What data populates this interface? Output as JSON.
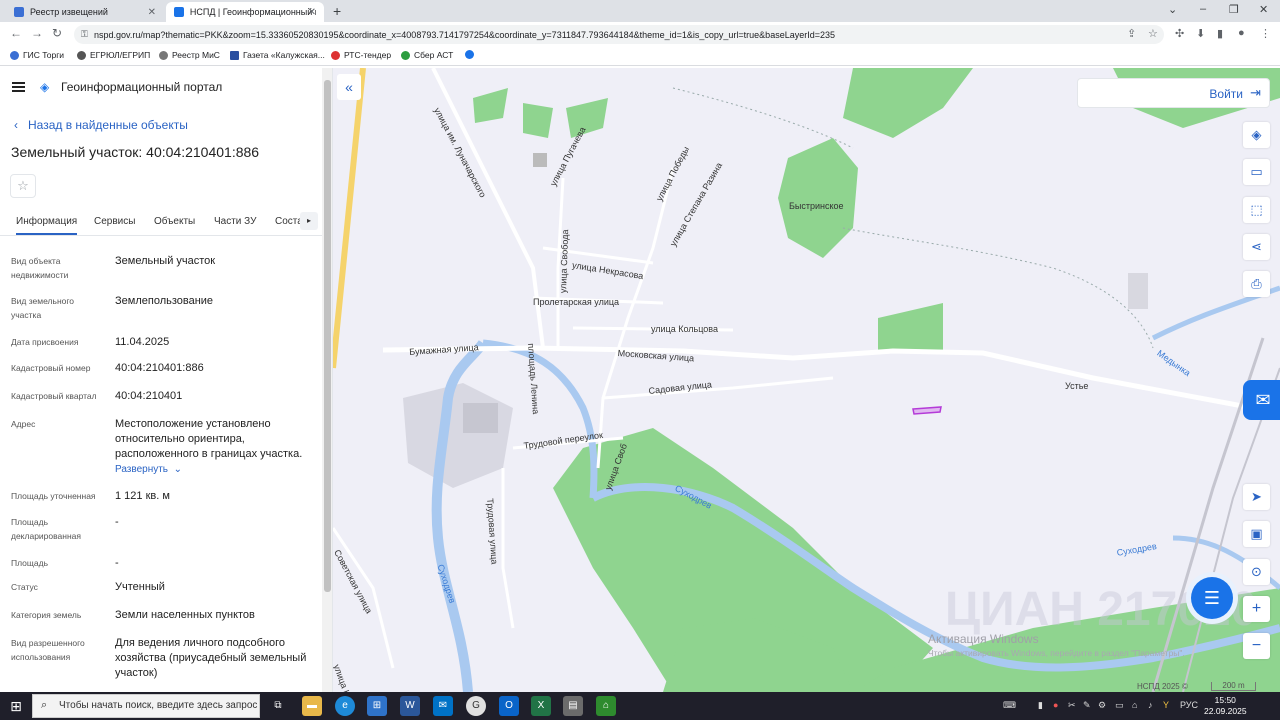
{
  "browser": {
    "tabs": [
      {
        "label": "Реестр извещений",
        "active": false
      },
      {
        "label": "НСПД | Геоинформационный п",
        "active": true
      }
    ],
    "url": "nspd.gov.ru/map?thematic=PKK&zoom=15.33360520830195&coordinate_x=4008793.7141797254&coordinate_y=7311847.793644184&theme_id=1&is_copy_url=true&baseLayerId=235",
    "bookmarks": [
      "ГИС Торги",
      "ЕГРЮЛ/ЕГРИП",
      "Реестр МиС",
      "Газета «Калужская...",
      "РТС-тендер",
      "Сбер АСТ"
    ]
  },
  "panel": {
    "portal_title": "Геоинформационный портал",
    "back_label": "Назад в найденные объекты",
    "object_title": "Земельный участок: 40:04:210401:886",
    "tabs": [
      "Информация",
      "Сервисы",
      "Объекты",
      "Части ЗУ",
      "Соста"
    ],
    "fields": [
      {
        "key": "Вид объекта недвижимости",
        "value": "Земельный участок"
      },
      {
        "key": "Вид земельного участка",
        "value": "Землепользование"
      },
      {
        "key": "Дата присвоения",
        "value": "11.04.2025"
      },
      {
        "key": "Кадастровый номер",
        "value": "40:04:210401:886"
      },
      {
        "key": "Кадастровый квартал",
        "value": "40:04:210401"
      },
      {
        "key": "Адрес",
        "value": "Местоположение установлено относительно ориентира, расположенного в границах участка.",
        "link": "Развернуть"
      },
      {
        "key": "Площадь уточненная",
        "value": "1 121 кв. м"
      },
      {
        "key": "Площадь декларированная",
        "value": "-"
      },
      {
        "key": "Площадь",
        "value": "-"
      },
      {
        "key": "Статус",
        "value": "Учтенный"
      },
      {
        "key": "Категория земель",
        "value": "Земли населенных пунктов"
      },
      {
        "key": "Вид разрешенного использования",
        "value": "Для ведения личного подсобного хозяйства (приусадебный земельный участок)"
      }
    ]
  },
  "map": {
    "login_label": "Войти",
    "labels": {
      "lunacharskogo": "улица им. Луначарского",
      "pugacheva": "улица Пугачева",
      "pobedy": "улица Победы",
      "razina": "улица Степана Разина",
      "svobody": "улица Свобода",
      "nekrasova": "улица Некрасова",
      "proletarskaya": "Пролетарская улица",
      "koltsova": "улица Кольцова",
      "bumazhnaya": "Бумажная улица",
      "moskovskaya": "Московская улица",
      "sadovaya": "Садовая улица",
      "lenina": "площадь Ленина",
      "trudovoy_per": "Трудовой переулок",
      "trudovaya": "Трудовая улица",
      "sovetskaya": "Советская улица",
      "kutu": "улица Куту",
      "bystrinskoe": "Быстринское",
      "ustye": "Устье",
      "medynka": "Медынка",
      "suhodrev1": "Суходрев",
      "suhodrev2": "Суходрев",
      "suhodrev3": "Суходрев",
      "svoby": "улица Своб"
    },
    "activation_title": "Активация Windows",
    "activation_text": "Чтобы активировать Windows, перейдите в раздел \"Параметры\".",
    "watermark": "ЦИАН 217020",
    "copyright": "НСПД 2025 ©",
    "scale": "200 m"
  },
  "taskbar": {
    "search_placeholder": "Чтобы начать поиск, введите здесь запрос",
    "lang": "РУС",
    "time": "15:50",
    "date": "22.09.2025"
  },
  "colors": {
    "accent": "#2a63c4",
    "green": "#8fd48f",
    "water": "#a9c9f0",
    "parcel": "#b43bd8"
  }
}
